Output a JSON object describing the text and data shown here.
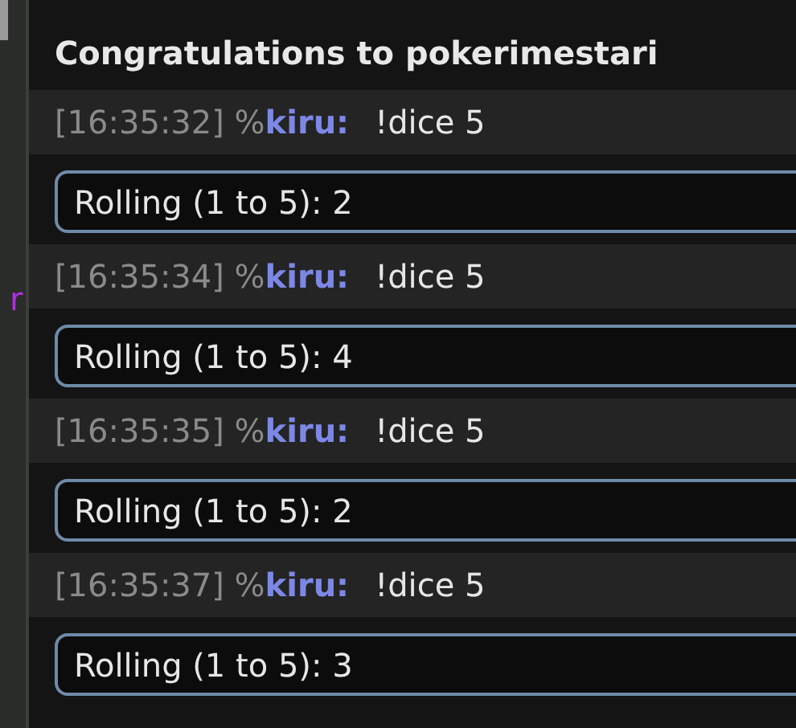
{
  "sidebar": {
    "text": "r"
  },
  "heading": "Congratulations to pokerimestari",
  "messages": [
    {
      "time": "[16:35:32]",
      "rank": "%",
      "user": "kiru:",
      "text": "!dice 5",
      "result": "Rolling (1 to 5): 2"
    },
    {
      "time": "[16:35:34]",
      "rank": "%",
      "user": "kiru:",
      "text": "!dice 5",
      "result": "Rolling (1 to 5): 4"
    },
    {
      "time": "[16:35:35]",
      "rank": "%",
      "user": "kiru:",
      "text": "!dice 5",
      "result": "Rolling (1 to 5): 2"
    },
    {
      "time": "[16:35:37]",
      "rank": "%",
      "user": "kiru:",
      "text": "!dice 5",
      "result": "Rolling (1 to 5): 3"
    }
  ]
}
